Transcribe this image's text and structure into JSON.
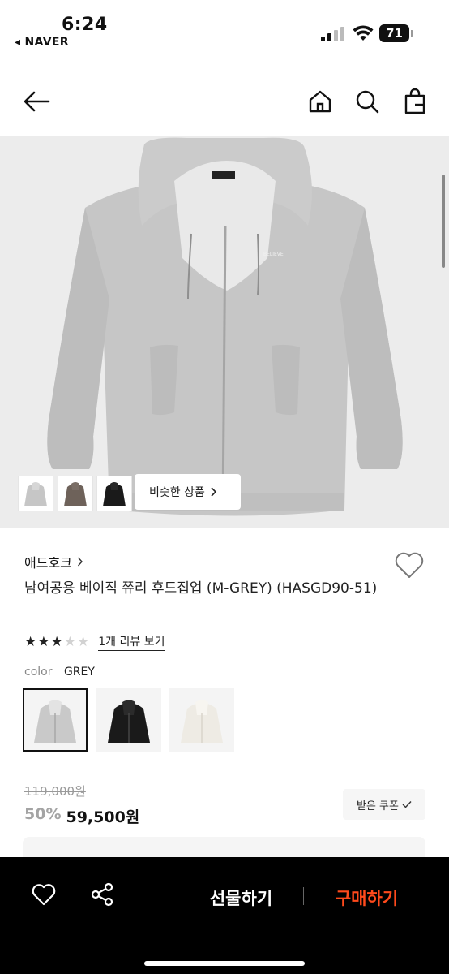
{
  "status_bar": {
    "time": "6:24",
    "back_app": "◂ NAVER",
    "battery": "71"
  },
  "nav": {
    "icons": [
      "back-arrow-icon",
      "home-icon",
      "search-icon",
      "shopping-bag-icon"
    ]
  },
  "gallery": {
    "logo_text": "BELIEVE",
    "similar_label": "비슷한 상품",
    "thumbnails": [
      "grey-hoodie",
      "brown-hoodie",
      "black-hoodie"
    ]
  },
  "product": {
    "brand": "애드호크",
    "brand_chevron": "›",
    "title": "남여공용 베이직 쮸리 후드집업 (M-GREY) (HASGD90-51)",
    "rating_filled": 3,
    "rating_max": 5,
    "review_link": "1개 리뷰 보기",
    "color_label": "color",
    "color_value": "GREY",
    "swatches": [
      "grey",
      "black",
      "cream"
    ],
    "original_price": "119,000원",
    "discount": "50%",
    "sale_price": "59,500원",
    "coupon_label": "받은 쿠폰"
  },
  "bottom_bar": {
    "gift_label": "선물하기",
    "buy_label": "구매하기"
  },
  "colors": {
    "buy_accent": "#ff4a1c",
    "hoodie_grey": "#c9c9c9",
    "hoodie_black": "#1a1a1a",
    "hoodie_brown": "#6e625a",
    "hoodie_cream": "#eeebe4"
  }
}
